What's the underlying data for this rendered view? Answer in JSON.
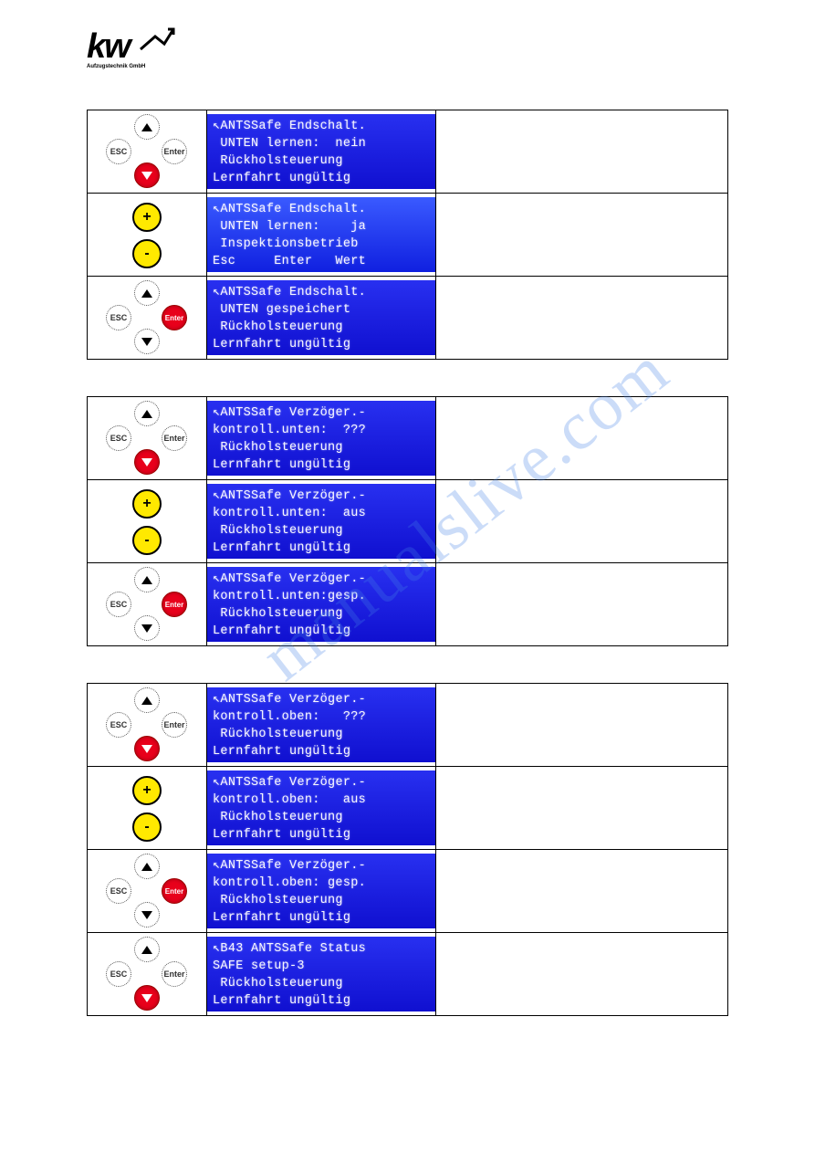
{
  "logo": {
    "main": "kw",
    "sub": "Aufzugstechnik GmbH"
  },
  "watermark": "manualslive.com",
  "btn_labels": {
    "esc": "ESC",
    "enter": "Enter",
    "plus": "+",
    "minus": "-"
  },
  "sections": [
    {
      "rows": [
        {
          "cluster": "nav-down-red",
          "lcd": [
            "↖ANTSSafe Endschalt.",
            " UNTEN lernen:  nein",
            " Rückholsteuerung",
            "Lernfahrt ungültig"
          ],
          "style": ""
        },
        {
          "cluster": "plus-minus",
          "lcd": [
            "↖ANTSSafe Endschalt.",
            " UNTEN lernen:    ja",
            " Inspektionsbetrieb",
            "Esc     Enter   Wert"
          ],
          "style": "lcd-row2"
        },
        {
          "cluster": "nav-enter-red",
          "lcd": [
            "↖ANTSSafe Endschalt.",
            " UNTEN gespeichert",
            " Rückholsteuerung",
            "Lernfahrt ungültig"
          ],
          "style": ""
        }
      ]
    },
    {
      "rows": [
        {
          "cluster": "nav-down-red",
          "lcd": [
            "↖ANTSSafe Verzöger.-",
            "kontroll.unten:  ???",
            " Rückholsteuerung",
            "Lernfahrt ungültig"
          ],
          "style": ""
        },
        {
          "cluster": "plus-minus",
          "lcd": [
            "↖ANTSSafe Verzöger.-",
            "kontroll.unten:  aus",
            " Rückholsteuerung",
            "Lernfahrt ungültig"
          ],
          "style": ""
        },
        {
          "cluster": "nav-enter-red",
          "lcd": [
            "↖ANTSSafe Verzöger.-",
            "kontroll.unten:gesp.",
            " Rückholsteuerung",
            "Lernfahrt ungültig"
          ],
          "style": ""
        }
      ]
    },
    {
      "rows": [
        {
          "cluster": "nav-down-red",
          "lcd": [
            "↖ANTSSafe Verzöger.-",
            "kontroll.oben:   ???",
            " Rückholsteuerung",
            "Lernfahrt ungültig"
          ],
          "style": ""
        },
        {
          "cluster": "plus-minus",
          "lcd": [
            "↖ANTSSafe Verzöger.-",
            "kontroll.oben:   aus",
            " Rückholsteuerung",
            "Lernfahrt ungültig"
          ],
          "style": ""
        },
        {
          "cluster": "nav-enter-red",
          "lcd": [
            "↖ANTSSafe Verzöger.-",
            "kontroll.oben: gesp.",
            " Rückholsteuerung",
            "Lernfahrt ungültig"
          ],
          "style": ""
        },
        {
          "cluster": "nav-down-red",
          "lcd": [
            "↖B43 ANTSSafe Status",
            "SAFE setup-3",
            " Rückholsteuerung",
            "Lernfahrt ungültig"
          ],
          "style": ""
        }
      ]
    }
  ]
}
